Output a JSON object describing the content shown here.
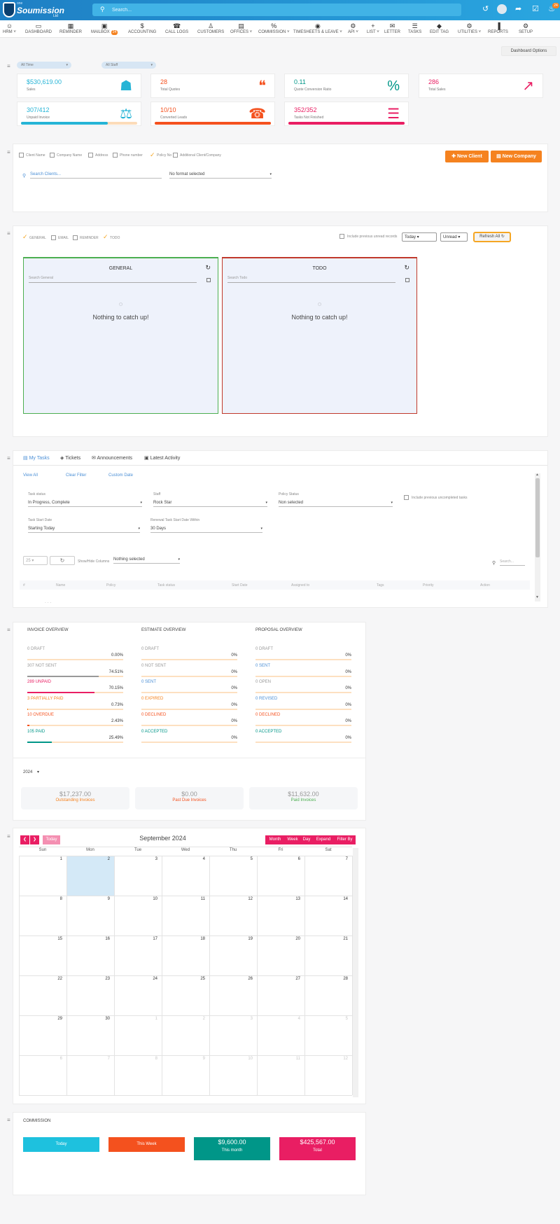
{
  "brand": {
    "line1": "one",
    "name": "Soumission",
    "tag": "Ltd"
  },
  "search": {
    "placeholder": "Search..."
  },
  "notif_count": "24",
  "nav": [
    {
      "label": "HRM",
      "icon": "person-icon",
      "caret": true
    },
    {
      "label": "DASHBOARD",
      "icon": "monitor-icon"
    },
    {
      "label": "REMINDER",
      "icon": "calendar-icon"
    },
    {
      "label": "MAILBOX",
      "icon": "mailbox-icon",
      "badge": "24"
    },
    {
      "label": "ACCOUNTING",
      "icon": "dollar-icon"
    },
    {
      "label": "CALL LOGS",
      "icon": "phone-icon"
    },
    {
      "label": "CUSTOMERS",
      "icon": "user-icon"
    },
    {
      "label": "OFFICES",
      "icon": "building-icon",
      "caret": true
    },
    {
      "label": "COMMISSION",
      "icon": "percent-icon",
      "caret": true
    },
    {
      "label": "TIMESHEETS & LEAVE",
      "icon": "user-circle-icon",
      "caret": true
    },
    {
      "label": "API",
      "icon": "gears-icon",
      "caret": true
    },
    {
      "label": "LIST",
      "icon": "plus-icon",
      "caret": true
    },
    {
      "label": "LETTER",
      "icon": "envelope-icon"
    },
    {
      "label": "TASKS",
      "icon": "tasks-icon"
    },
    {
      "label": "EDIT TAG",
      "icon": "tag-icon"
    },
    {
      "label": "UTILITIES",
      "icon": "cogs-icon",
      "caret": true
    },
    {
      "label": "REPORTS",
      "icon": "bar-chart-icon"
    },
    {
      "label": "SETUP",
      "icon": "gear-icon"
    }
  ],
  "dashboard_options": "Dashboard Options",
  "filters": {
    "time": "All Time",
    "staff": "All Staff"
  },
  "stats": [
    {
      "value": "$530,619.00",
      "label": "Sales",
      "color": "#26b4d6",
      "icon": "cart-icon"
    },
    {
      "value": "28",
      "label": "Total Quotes",
      "color": "#f4511e",
      "icon": "quote-icon"
    },
    {
      "value": "0.11",
      "label": "Quote Conversion Ratio",
      "color": "#009688",
      "icon": "percent-icon"
    },
    {
      "value": "286",
      "label": "Total Sales",
      "color": "#e91e63",
      "icon": "trend-icon"
    },
    {
      "value": "307/412",
      "label": "Unpaid Invoice",
      "color": "#26b4d6",
      "icon": "scale-icon",
      "progress": 0.745
    },
    {
      "value": "10/10",
      "label": "Converted Leads",
      "color": "#f4511e",
      "icon": "phone-icon",
      "progress": 1
    },
    {
      "value": "352/352",
      "label": "Tasks Not Finished",
      "color": "#e91e63",
      "icon": "server-icon",
      "progress": 1
    }
  ],
  "clients": {
    "options": [
      "Client Name",
      "Company Name",
      "Address",
      "Phone number",
      "Policy No",
      "Additional Client/Company"
    ],
    "checked": [
      "Policy No"
    ],
    "new_client": "New Client",
    "new_company": "New Company",
    "search_placeholder": "Search Clients...",
    "format": "No format selected"
  },
  "feed": {
    "options": [
      "GENERAL",
      "EMAIL",
      "REMINDER",
      "TODO"
    ],
    "checked": [
      "GENERAL",
      "TODO"
    ],
    "include_prev": "Include previous unread records",
    "period": "Today",
    "status": "Unread",
    "refresh": "Refresh All",
    "panels": [
      {
        "title": "GENERAL",
        "search": "Search General",
        "empty": "Nothing to catch up!",
        "border": "#4caf50"
      },
      {
        "title": "TODO",
        "search": "Search Todo",
        "empty": "Nothing to catch up!",
        "border": "#c0392b"
      }
    ]
  },
  "tasks": {
    "tabs": [
      "My Tasks",
      "Tickets",
      "Announcements",
      "Latest Activity"
    ],
    "links": [
      "View All",
      "Clear Filter",
      "Custom Date"
    ],
    "task_status_label": "Task status",
    "task_status": "In Progress, Complete",
    "staff_label": "Staff",
    "staff": "Rock Star",
    "policy_label": "Policy Status",
    "policy": "Non selected",
    "include_prev": "Include previous uncompleted tasks",
    "start_label": "Task Start Date",
    "start": "Starting Today",
    "renewal_label": "Renewal Task Start Date Within",
    "renewal": "30 Days",
    "page_size": "25",
    "show_hide": "Show/Hide Columns",
    "cols": "Nothing selected",
    "search": "Search...",
    "columns": [
      "#",
      "Name",
      "Policy",
      "Task status",
      "Start Date",
      "Assigned to",
      "Tags",
      "Priority",
      "Action"
    ]
  },
  "overview": {
    "invoice": {
      "title": "INVOICE OVERVIEW",
      "rows": [
        {
          "label": "0 DRAFT",
          "pct": "0.00%",
          "v": 0,
          "color": "#999"
        },
        {
          "label": "307 NOT SENT",
          "pct": "74.51%",
          "v": 0.745,
          "color": "#999"
        },
        {
          "label": "289 UNPAID",
          "pct": "70.15%",
          "v": 0.7,
          "color": "#e91e63"
        },
        {
          "label": "3 PARTIALLY PAID",
          "pct": "0.73%",
          "v": 0.007,
          "color": "#f5821f"
        },
        {
          "label": "10 OVERDUE",
          "pct": "2.43%",
          "v": 0.024,
          "color": "#f4511e"
        },
        {
          "label": "105 PAID",
          "pct": "25.49%",
          "v": 0.255,
          "color": "#009688"
        }
      ]
    },
    "estimate": {
      "title": "ESTIMATE OVERVIEW",
      "rows": [
        {
          "label": "0 DRAFT",
          "pct": "0%",
          "v": 0,
          "color": "#999"
        },
        {
          "label": "0 NOT SENT",
          "pct": "0%",
          "v": 0,
          "color": "#999"
        },
        {
          "label": "0 SENT",
          "pct": "0%",
          "v": 0,
          "color": "#4b8fd6"
        },
        {
          "label": "0 EXPIRED",
          "pct": "0%",
          "v": 0,
          "color": "#f5821f"
        },
        {
          "label": "0 DECLINED",
          "pct": "0%",
          "v": 0,
          "color": "#f4511e"
        },
        {
          "label": "0 ACCEPTED",
          "pct": "0%",
          "v": 0,
          "color": "#009688"
        }
      ]
    },
    "proposal": {
      "title": "PROPOSAL OVERVIEW",
      "rows": [
        {
          "label": "0 DRAFT",
          "pct": "0%",
          "v": 0,
          "color": "#999"
        },
        {
          "label": "0 SENT",
          "pct": "0%",
          "v": 0,
          "color": "#4b8fd6"
        },
        {
          "label": "0 OPEN",
          "pct": "0%",
          "v": 0,
          "color": "#999"
        },
        {
          "label": "0 REVISED",
          "pct": "0%",
          "v": 0,
          "color": "#4b8fd6"
        },
        {
          "label": "0 DECLINED",
          "pct": "0%",
          "v": 0,
          "color": "#f4511e"
        },
        {
          "label": "0 ACCEPTED",
          "pct": "0%",
          "v": 0,
          "color": "#009688"
        }
      ]
    },
    "year": "2024",
    "summary": [
      {
        "value": "$17,237.00",
        "label": "Outstanding Invoices",
        "color": "#f5821f"
      },
      {
        "value": "$0.00",
        "label": "Past Due Invoices",
        "color": "#f4511e"
      },
      {
        "value": "$11,632.00",
        "label": "Paid Invoices",
        "color": "#4caf50"
      }
    ]
  },
  "calendar": {
    "title": "September 2024",
    "today": "Today",
    "views": [
      "Month",
      "Week",
      "Day",
      "Expand",
      "Filter By"
    ],
    "dow": [
      "Sun",
      "Mon",
      "Tue",
      "Wed",
      "Thu",
      "Fri",
      "Sat"
    ],
    "weeks": [
      [
        "1",
        "2",
        "3",
        "4",
        "5",
        "6",
        "7"
      ],
      [
        "8",
        "9",
        "10",
        "11",
        "12",
        "13",
        "14"
      ],
      [
        "15",
        "16",
        "17",
        "18",
        "19",
        "20",
        "21"
      ],
      [
        "22",
        "23",
        "24",
        "25",
        "26",
        "27",
        "28"
      ],
      [
        "29",
        "30",
        "1",
        "2",
        "3",
        "4",
        "5"
      ],
      [
        "6",
        "7",
        "8",
        "9",
        "10",
        "11",
        "12"
      ]
    ]
  },
  "commission": {
    "title": "COMMISSION",
    "tiles": [
      {
        "amount": "",
        "label": "Today",
        "color": "#1ec1de"
      },
      {
        "amount": "",
        "label": "This Week",
        "color": "#f4511e"
      },
      {
        "amount": "$9,600.00",
        "label": "This month",
        "color": "#009688"
      },
      {
        "amount": "$425,567.00",
        "label": "Total",
        "color": "#e91e63"
      }
    ]
  }
}
